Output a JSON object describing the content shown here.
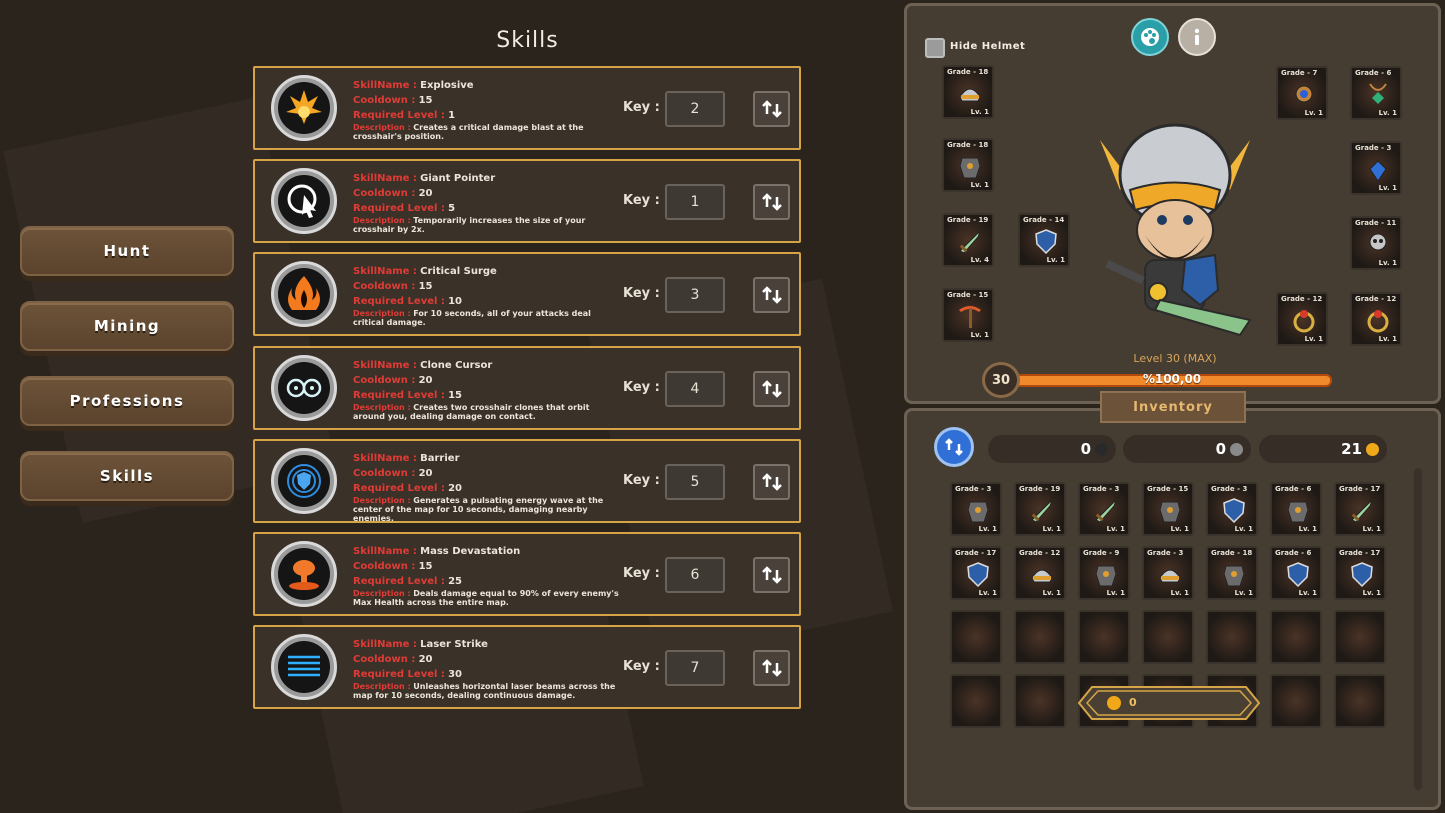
{
  "nav": {
    "hunt": "Hunt",
    "mining": "Mining",
    "professions": "Professions",
    "skills": "Skills"
  },
  "skills_panel": {
    "title": "Skills",
    "name_label": "SkillName :",
    "cooldown_label": "Cooldown :",
    "level_label": "Required Level :",
    "desc_label": "Description :",
    "key_label": "Key :",
    "skills": [
      {
        "name": "Explosive",
        "cooldown": "15",
        "level": "1",
        "desc": "Creates a critical damage blast at the crosshair's position.",
        "key": "2",
        "icon": "explosion-icon"
      },
      {
        "name": "Giant Pointer",
        "cooldown": "20",
        "level": "5",
        "desc": "Temporarily increases the size of your crosshair by 2x.",
        "key": "1",
        "icon": "giant-cursor-icon"
      },
      {
        "name": "Critical Surge",
        "cooldown": "15",
        "level": "10",
        "desc": "For 10 seconds, all of your attacks deal critical damage.",
        "key": "3",
        "icon": "flame-icon"
      },
      {
        "name": "Clone Cursor",
        "cooldown": "20",
        "level": "15",
        "desc": "Creates two crosshair clones that orbit around you, dealing damage on contact.",
        "key": "4",
        "icon": "double-crosshair-icon"
      },
      {
        "name": "Barrier",
        "cooldown": "20",
        "level": "20",
        "desc": "Generates a pulsating energy wave at the center of the map for 10 seconds, damaging nearby enemies.",
        "key": "5",
        "icon": "shield-wave-icon"
      },
      {
        "name": "Mass Devastation",
        "cooldown": "15",
        "level": "25",
        "desc": "Deals damage equal to 90% of every enemy's Max Health across the entire map.",
        "key": "6",
        "icon": "nuke-icon"
      },
      {
        "name": "Laser Strike",
        "cooldown": "20",
        "level": "30",
        "desc": "Unleashes horizontal laser beams across the map for 10 seconds, dealing continuous damage.",
        "key": "7",
        "icon": "laser-icon"
      }
    ]
  },
  "equipment": {
    "hide_helmet": "Hide Helmet",
    "level_text": "Level 30 (MAX)",
    "level_badge": "30",
    "xp_text": "%100,00",
    "xp_fraction": 1.0,
    "slots_left": [
      {
        "grade": "Grade - 18",
        "lv": "Lv. 1",
        "icon": "helmet-icon"
      },
      {
        "grade": "Grade - 18",
        "lv": "Lv. 1",
        "icon": "armor-icon"
      },
      {
        "grade": "Grade - 19",
        "lv": "Lv. 4",
        "icon": "sword-icon"
      },
      {
        "grade": "Grade - 14",
        "lv": "Lv. 1",
        "icon": "shield-icon"
      },
      {
        "grade": "Grade - 15",
        "lv": "Lv. 1",
        "icon": "pickaxe-icon"
      }
    ],
    "slots_right": [
      {
        "grade": "Grade - 7",
        "lv": "Lv. 1",
        "icon": "amulet-icon"
      },
      {
        "grade": "Grade - 6",
        "lv": "Lv. 1",
        "icon": "necklace-icon"
      },
      {
        "grade": "Grade - 3",
        "lv": "Lv. 1",
        "icon": "pendant-icon"
      },
      {
        "grade": "Grade - 11",
        "lv": "Lv. 1",
        "icon": "skull-charm-icon"
      },
      {
        "grade": "Grade - 12",
        "lv": "Lv. 1",
        "icon": "ring-icon"
      },
      {
        "grade": "Grade - 12",
        "lv": "Lv. 1",
        "icon": "ring-icon"
      }
    ]
  },
  "inventory": {
    "title": "Inventory",
    "currency": [
      {
        "value": "0",
        "icon": "dark-ore-icon",
        "color": "#2a2a2a"
      },
      {
        "value": "0",
        "icon": "stone-ore-icon",
        "color": "#8a8a8a"
      },
      {
        "value": "21",
        "icon": "gold-coin-icon",
        "color": "#f0a818"
      }
    ],
    "sell_value": "0",
    "row1": [
      {
        "grade": "Grade - 3",
        "lv": "Lv. 1",
        "icon": "armor-icon"
      },
      {
        "grade": "Grade - 19",
        "lv": "Lv. 1",
        "icon": "sword-icon"
      },
      {
        "grade": "Grade - 3",
        "lv": "Lv. 1",
        "icon": "sword-icon"
      },
      {
        "grade": "Grade - 15",
        "lv": "Lv. 1",
        "icon": "armor-icon"
      },
      {
        "grade": "Grade - 3",
        "lv": "Lv. 1",
        "icon": "shield-icon"
      },
      {
        "grade": "Grade - 6",
        "lv": "Lv. 1",
        "icon": "armor-icon"
      },
      {
        "grade": "Grade - 17",
        "lv": "Lv. 1",
        "icon": "sword-icon"
      }
    ],
    "row2": [
      {
        "grade": "Grade - 17",
        "lv": "Lv. 1",
        "icon": "shield-icon"
      },
      {
        "grade": "Grade - 12",
        "lv": "Lv. 1",
        "icon": "helmet-icon"
      },
      {
        "grade": "Grade - 9",
        "lv": "Lv. 1",
        "icon": "armor-icon"
      },
      {
        "grade": "Grade - 3",
        "lv": "Lv. 1",
        "icon": "helmet-icon"
      },
      {
        "grade": "Grade - 18",
        "lv": "Lv. 1",
        "icon": "armor-icon"
      },
      {
        "grade": "Grade - 6",
        "lv": "Lv. 1",
        "icon": "shield-icon"
      },
      {
        "grade": "Grade - 17",
        "lv": "Lv. 1",
        "icon": "shield-icon"
      }
    ]
  }
}
